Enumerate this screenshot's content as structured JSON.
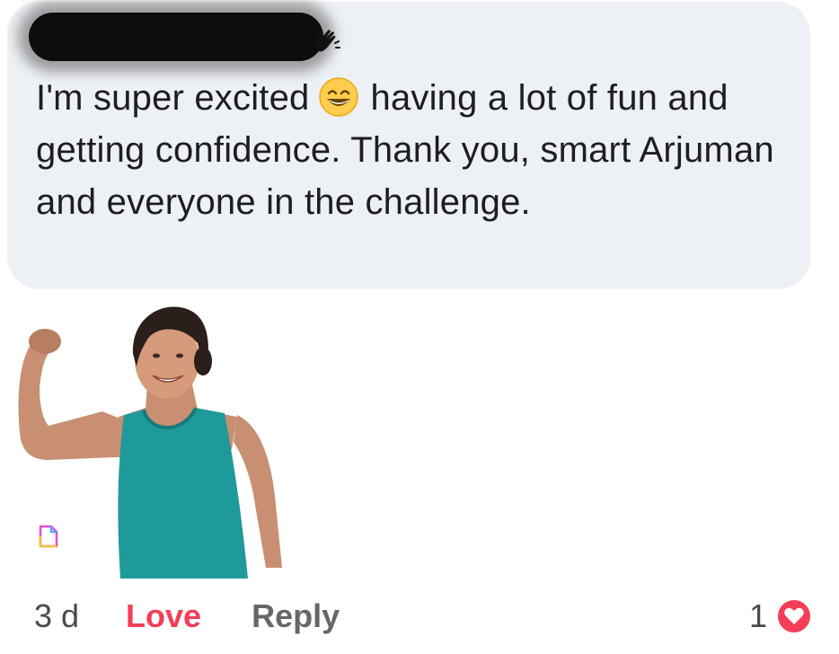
{
  "comment": {
    "text_part1": "I'm super excited",
    "emoji": "grinning-smiling-eyes-emoji",
    "text_part2": "having a lot of fun and getting confidence.  Thank you, smart Arjuman and everyone in the challenge."
  },
  "actions": {
    "timestamp": "3 d",
    "love_label": "Love",
    "reply_label": "Reply"
  },
  "reactions": {
    "count": "1",
    "icon": "heart-reaction-icon",
    "color": "#f33e58"
  },
  "colors": {
    "bubble": "#edf0f4",
    "text": "#1c1e21",
    "love": "#f33e58",
    "reply": "#65676b"
  }
}
